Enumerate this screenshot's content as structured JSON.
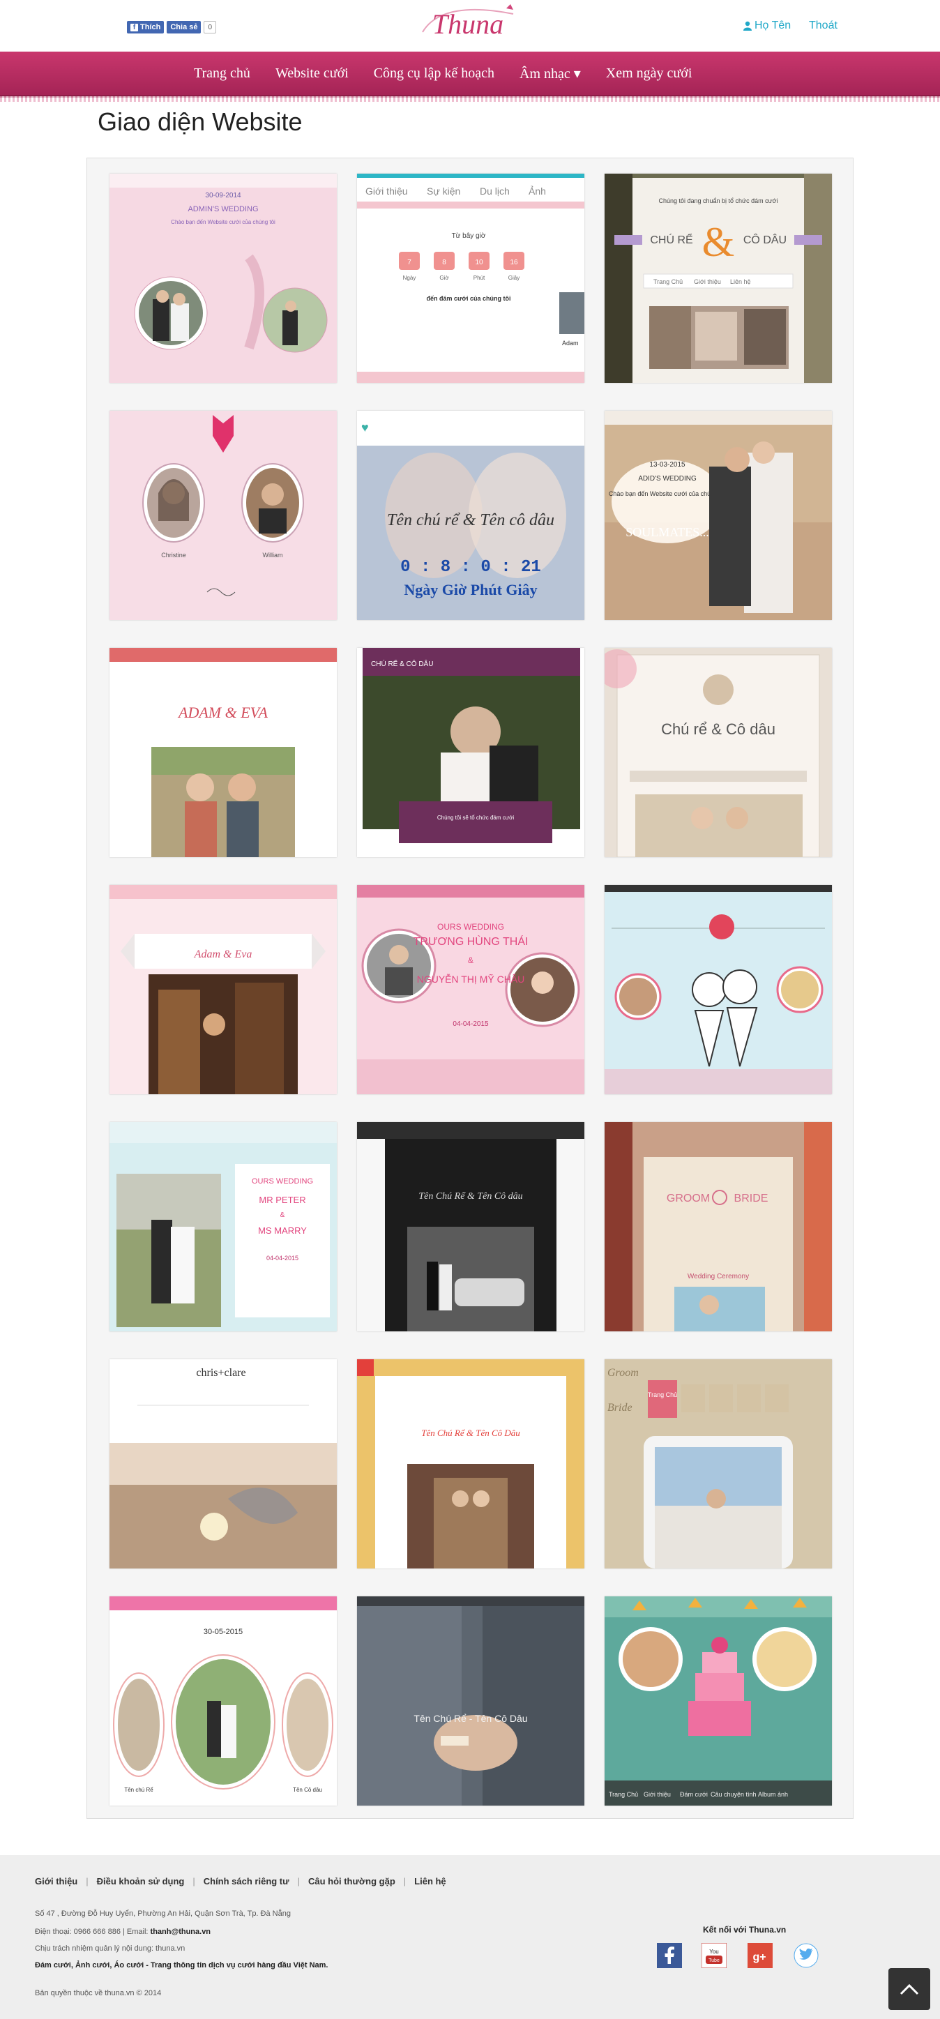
{
  "header": {
    "fb_like_label": "Thích",
    "fb_share_label": "Chia sẻ",
    "fb_count": "0",
    "logo_text": "Thuna",
    "user_name": "Họ Tên",
    "logout_label": "Thoát"
  },
  "nav": {
    "items": [
      "Trang chủ",
      "Website cưới",
      "Công cụ lập kế hoạch",
      "Âm nhạc ▾",
      "Xem ngày cưới"
    ]
  },
  "page": {
    "title": "Giao diện Website"
  },
  "templates": [
    {
      "name": "template-1",
      "texts": [
        "30-09-2014",
        "ADMIN'S WEDDING",
        "Chào bạn đến Website cưới của chúng tôi"
      ]
    },
    {
      "name": "template-2",
      "texts": [
        "Giới thiệu",
        "Sự kiện",
        "Du lịch",
        "Ảnh",
        "Từ bây giờ",
        "7",
        "8",
        "10",
        "16",
        "Ngày",
        "Giờ",
        "Phút",
        "Giây",
        "đến đám cưới của chúng tôi",
        "Adam"
      ]
    },
    {
      "name": "template-3",
      "texts": [
        "Chúng tôi đang chuẩn bị tổ chức đám cưới",
        "CHÚ RỂ",
        "&",
        "CÔ DÂU",
        "Trang Chủ",
        "Giới thiệu",
        "Liên hệ"
      ]
    },
    {
      "name": "template-4",
      "texts": [
        "Christine",
        "William"
      ]
    },
    {
      "name": "template-5",
      "texts": [
        "Tên chú rể & Tên cô dâu",
        "0 : 8 : 0 : 21",
        "Ngày Giờ Phút Giây"
      ]
    },
    {
      "name": "template-6",
      "texts": [
        "13-03-2015",
        "ADID'S WEDDING",
        "Chào bạn đến Website cưới của chúng tôi",
        "SOULMATES..."
      ]
    },
    {
      "name": "template-7",
      "texts": [
        "ADAM & EVA"
      ]
    },
    {
      "name": "template-8",
      "texts": [
        "CHÚ RỂ & CÔ DÂU",
        "Chúng tôi sẽ tổ chức đám cưới"
      ]
    },
    {
      "name": "template-9",
      "texts": [
        "Chú rể & Cô dâu"
      ]
    },
    {
      "name": "template-10",
      "texts": [
        "Adam & Eva"
      ]
    },
    {
      "name": "template-11",
      "texts": [
        "OURS WEDDING",
        "TRƯƠNG HÙNG THÁI",
        "&",
        "NGUYỄN THỊ MỸ CHÂU",
        "04-04-2015"
      ]
    },
    {
      "name": "template-12",
      "texts": []
    },
    {
      "name": "template-13",
      "texts": [
        "OURS WEDDING",
        "MR PETER",
        "&",
        "MS MARRY",
        "04-04-2015"
      ]
    },
    {
      "name": "template-14",
      "texts": [
        "Tên Chú Rể & Tên Cô dâu"
      ]
    },
    {
      "name": "template-15",
      "texts": [
        "GROOM",
        "BRIDE",
        "Wedding Ceremony"
      ]
    },
    {
      "name": "template-16",
      "texts": [
        "chris+clare"
      ]
    },
    {
      "name": "template-17",
      "texts": [
        "Tên Chú Rể & Tên Cô Dâu"
      ]
    },
    {
      "name": "template-18",
      "texts": [
        "Groom",
        "Bride",
        "Trang Chủ"
      ]
    },
    {
      "name": "template-19",
      "texts": [
        "30-05-2015",
        "Tên chú Rể",
        "Tên Cô dâu"
      ]
    },
    {
      "name": "template-20",
      "texts": [
        "Tên Chú Rể - Tên Cô Dâu"
      ]
    },
    {
      "name": "template-21",
      "texts": [
        "Trang Chủ",
        "Giới thiệu",
        "Đám cưới",
        "Câu chuyện tình",
        "Album ảnh"
      ]
    }
  ],
  "footer": {
    "links": [
      "Giới thiệu",
      "Điều khoản sử dụng",
      "Chính sách riêng tư",
      "Câu hỏi thường gặp",
      "Liên hệ"
    ],
    "address": "Số 47 , Đường Đỗ Huy Uyển, Phường An Hải, Quận Sơn Trà, Tp. Đà Nẵng",
    "phone_prefix": "Điện thoại: 0966 666 886 | Email:",
    "email": "thanh@thuna.vn",
    "responsible": "Chịu trách nhiệm quản lý nội dung: thuna.vn",
    "tagline": "Đám cưới, Ảnh cưới, Áo cưới - Trang thông tin dịch vụ cưới hàng đầu Việt Nam.",
    "copyright": "Bản quyền thuộc về thuna.vn © 2014",
    "connect_title": "Kết nối với Thuna.vn",
    "social": [
      "facebook-icon",
      "youtube-icon",
      "google-plus-icon",
      "twitter-icon"
    ]
  },
  "colors": {
    "nav_bg": "#b52a5f",
    "link": "#20a8c8",
    "footer_bg": "#eeeeee"
  }
}
